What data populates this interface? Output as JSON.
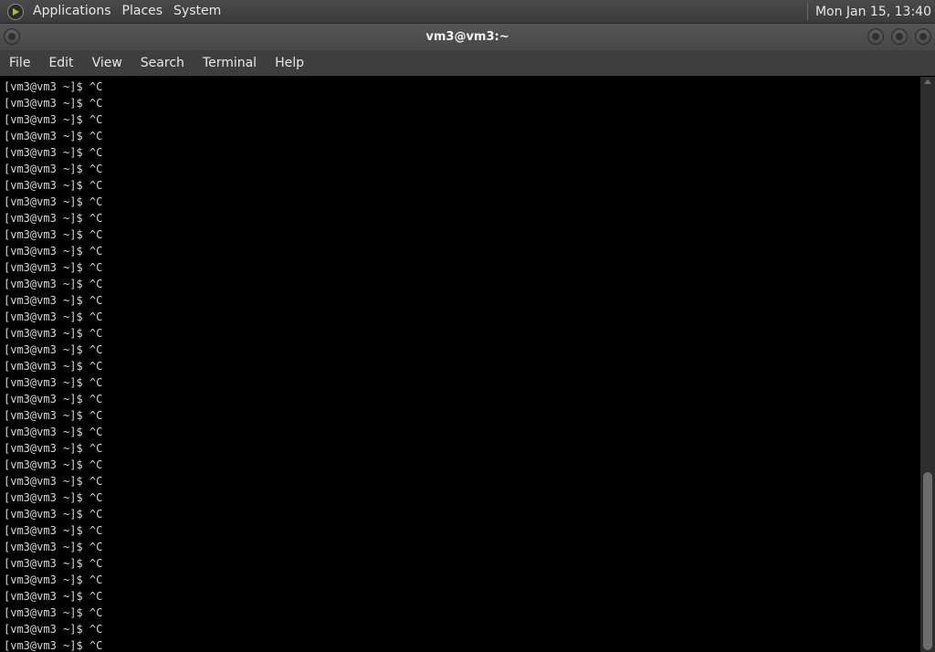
{
  "panel": {
    "menus": [
      "Applications",
      "Places",
      "System"
    ],
    "clock": "Mon Jan 15, 13:40"
  },
  "window": {
    "title": "vm3@vm3:~"
  },
  "menubar": {
    "items": [
      "File",
      "Edit",
      "View",
      "Search",
      "Terminal",
      "Help"
    ]
  },
  "terminal": {
    "lines": [
      "[vm3@vm3 ~]$ ^C",
      "[vm3@vm3 ~]$ ^C",
      "[vm3@vm3 ~]$ ^C",
      "[vm3@vm3 ~]$ ^C",
      "[vm3@vm3 ~]$ ^C",
      "[vm3@vm3 ~]$ ^C",
      "[vm3@vm3 ~]$ ^C",
      "[vm3@vm3 ~]$ ^C",
      "[vm3@vm3 ~]$ ^C",
      "[vm3@vm3 ~]$ ^C",
      "[vm3@vm3 ~]$ ^C",
      "[vm3@vm3 ~]$ ^C",
      "[vm3@vm3 ~]$ ^C",
      "[vm3@vm3 ~]$ ^C",
      "[vm3@vm3 ~]$ ^C",
      "[vm3@vm3 ~]$ ^C",
      "[vm3@vm3 ~]$ ^C",
      "[vm3@vm3 ~]$ ^C",
      "[vm3@vm3 ~]$ ^C",
      "[vm3@vm3 ~]$ ^C",
      "[vm3@vm3 ~]$ ^C",
      "[vm3@vm3 ~]$ ^C",
      "[vm3@vm3 ~]$ ^C",
      "[vm3@vm3 ~]$ ^C",
      "[vm3@vm3 ~]$ ^C",
      "[vm3@vm3 ~]$ ^C",
      "[vm3@vm3 ~]$ ^C",
      "[vm3@vm3 ~]$ ^C",
      "[vm3@vm3 ~]$ ^C",
      "[vm3@vm3 ~]$ ^C",
      "[vm3@vm3 ~]$ ^C",
      "[vm3@vm3 ~]$ ^C",
      "[vm3@vm3 ~]$ ^C",
      "[vm3@vm3 ~]$ ^C",
      "[vm3@vm3 ~]$ ^C"
    ]
  },
  "scrollbar": {
    "position_fraction": 0.98
  }
}
